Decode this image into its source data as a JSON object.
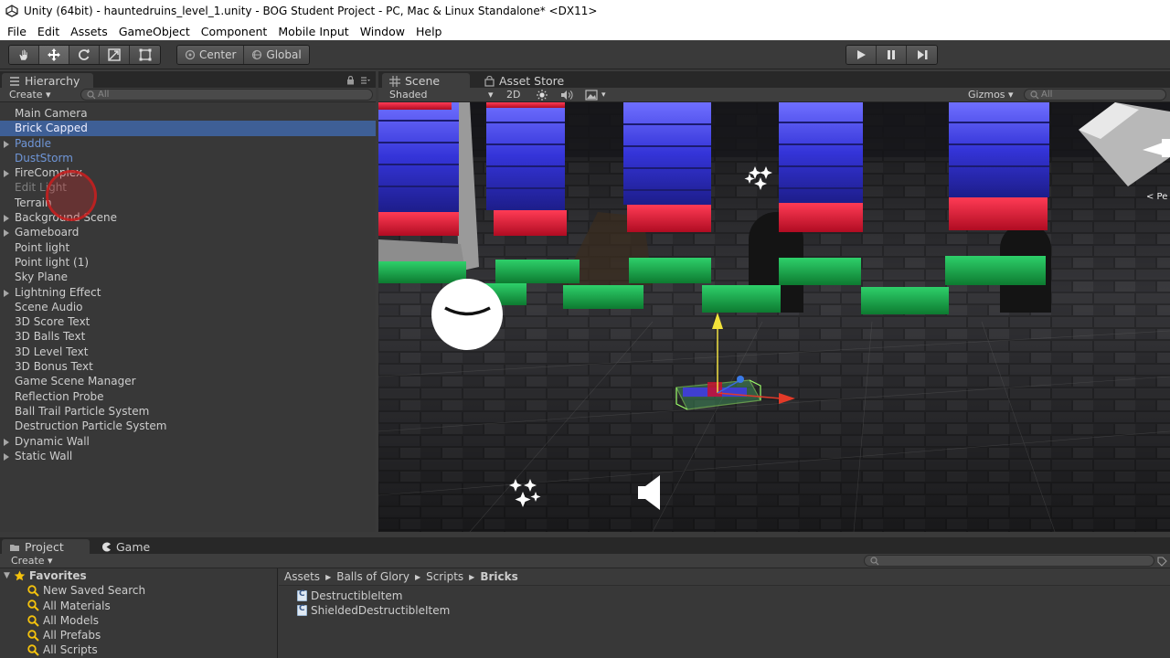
{
  "window": {
    "title": "Unity (64bit) - hauntedruins_level_1.unity - BOG Student Project - PC, Mac & Linux Standalone* <DX11>"
  },
  "menu": [
    "File",
    "Edit",
    "Assets",
    "GameObject",
    "Component",
    "Mobile Input",
    "Window",
    "Help"
  ],
  "toolbar": {
    "pivot": "Center",
    "space": "Global"
  },
  "hierarchy": {
    "tab": "Hierarchy",
    "create": "Create",
    "search_placeholder": "All",
    "items": [
      {
        "label": "Main Camera",
        "arrow": false,
        "style": ""
      },
      {
        "label": "Brick Capped",
        "arrow": false,
        "style": "sel"
      },
      {
        "label": "Paddle",
        "arrow": true,
        "style": "prefab"
      },
      {
        "label": "DustStorm",
        "arrow": false,
        "style": "prefab"
      },
      {
        "label": "FireComplex",
        "arrow": true,
        "style": ""
      },
      {
        "label": "Edit Light",
        "arrow": false,
        "style": "disabled"
      },
      {
        "label": "Terrain",
        "arrow": false,
        "style": ""
      },
      {
        "label": "Background Scene",
        "arrow": true,
        "style": ""
      },
      {
        "label": "Gameboard",
        "arrow": true,
        "style": ""
      },
      {
        "label": "Point light",
        "arrow": false,
        "style": ""
      },
      {
        "label": "Point light (1)",
        "arrow": false,
        "style": ""
      },
      {
        "label": "Sky Plane",
        "arrow": false,
        "style": ""
      },
      {
        "label": "Lightning Effect",
        "arrow": true,
        "style": ""
      },
      {
        "label": "Scene Audio",
        "arrow": false,
        "style": ""
      },
      {
        "label": "3D Score Text",
        "arrow": false,
        "style": ""
      },
      {
        "label": "3D Balls Text",
        "arrow": false,
        "style": ""
      },
      {
        "label": "3D Level Text",
        "arrow": false,
        "style": ""
      },
      {
        "label": "3D Bonus Text",
        "arrow": false,
        "style": ""
      },
      {
        "label": "Game Scene Manager",
        "arrow": false,
        "style": ""
      },
      {
        "label": "Reflection Probe",
        "arrow": false,
        "style": ""
      },
      {
        "label": "Ball Trail Particle System",
        "arrow": false,
        "style": ""
      },
      {
        "label": "Destruction Particle System",
        "arrow": false,
        "style": ""
      },
      {
        "label": "Dynamic Wall",
        "arrow": true,
        "style": ""
      },
      {
        "label": "Static Wall",
        "arrow": true,
        "style": ""
      }
    ]
  },
  "scene": {
    "tab_scene": "Scene",
    "tab_store": "Asset Store",
    "shading": "Shaded",
    "mode_2d": "2D",
    "gizmos": "Gizmos",
    "search_placeholder": "All",
    "gizmo_label": "< Pe"
  },
  "project": {
    "tab_project": "Project",
    "tab_game": "Game",
    "create": "Create",
    "favorites_title": "Favorites",
    "favorites": [
      "New Saved Search",
      "All Materials",
      "All Models",
      "All Prefabs",
      "All Scripts"
    ],
    "breadcrumb": [
      "Assets",
      "Balls of Glory",
      "Scripts",
      "Bricks"
    ],
    "files": [
      "DestructibleItem",
      "ShieldedDestructibleItem"
    ]
  },
  "colors": {
    "selection": "#3e5f96",
    "prefab_text": "#6f96d8",
    "brick_blue": "#3a3ad8",
    "brick_red": "#e01030",
    "brick_green": "#14a040"
  }
}
